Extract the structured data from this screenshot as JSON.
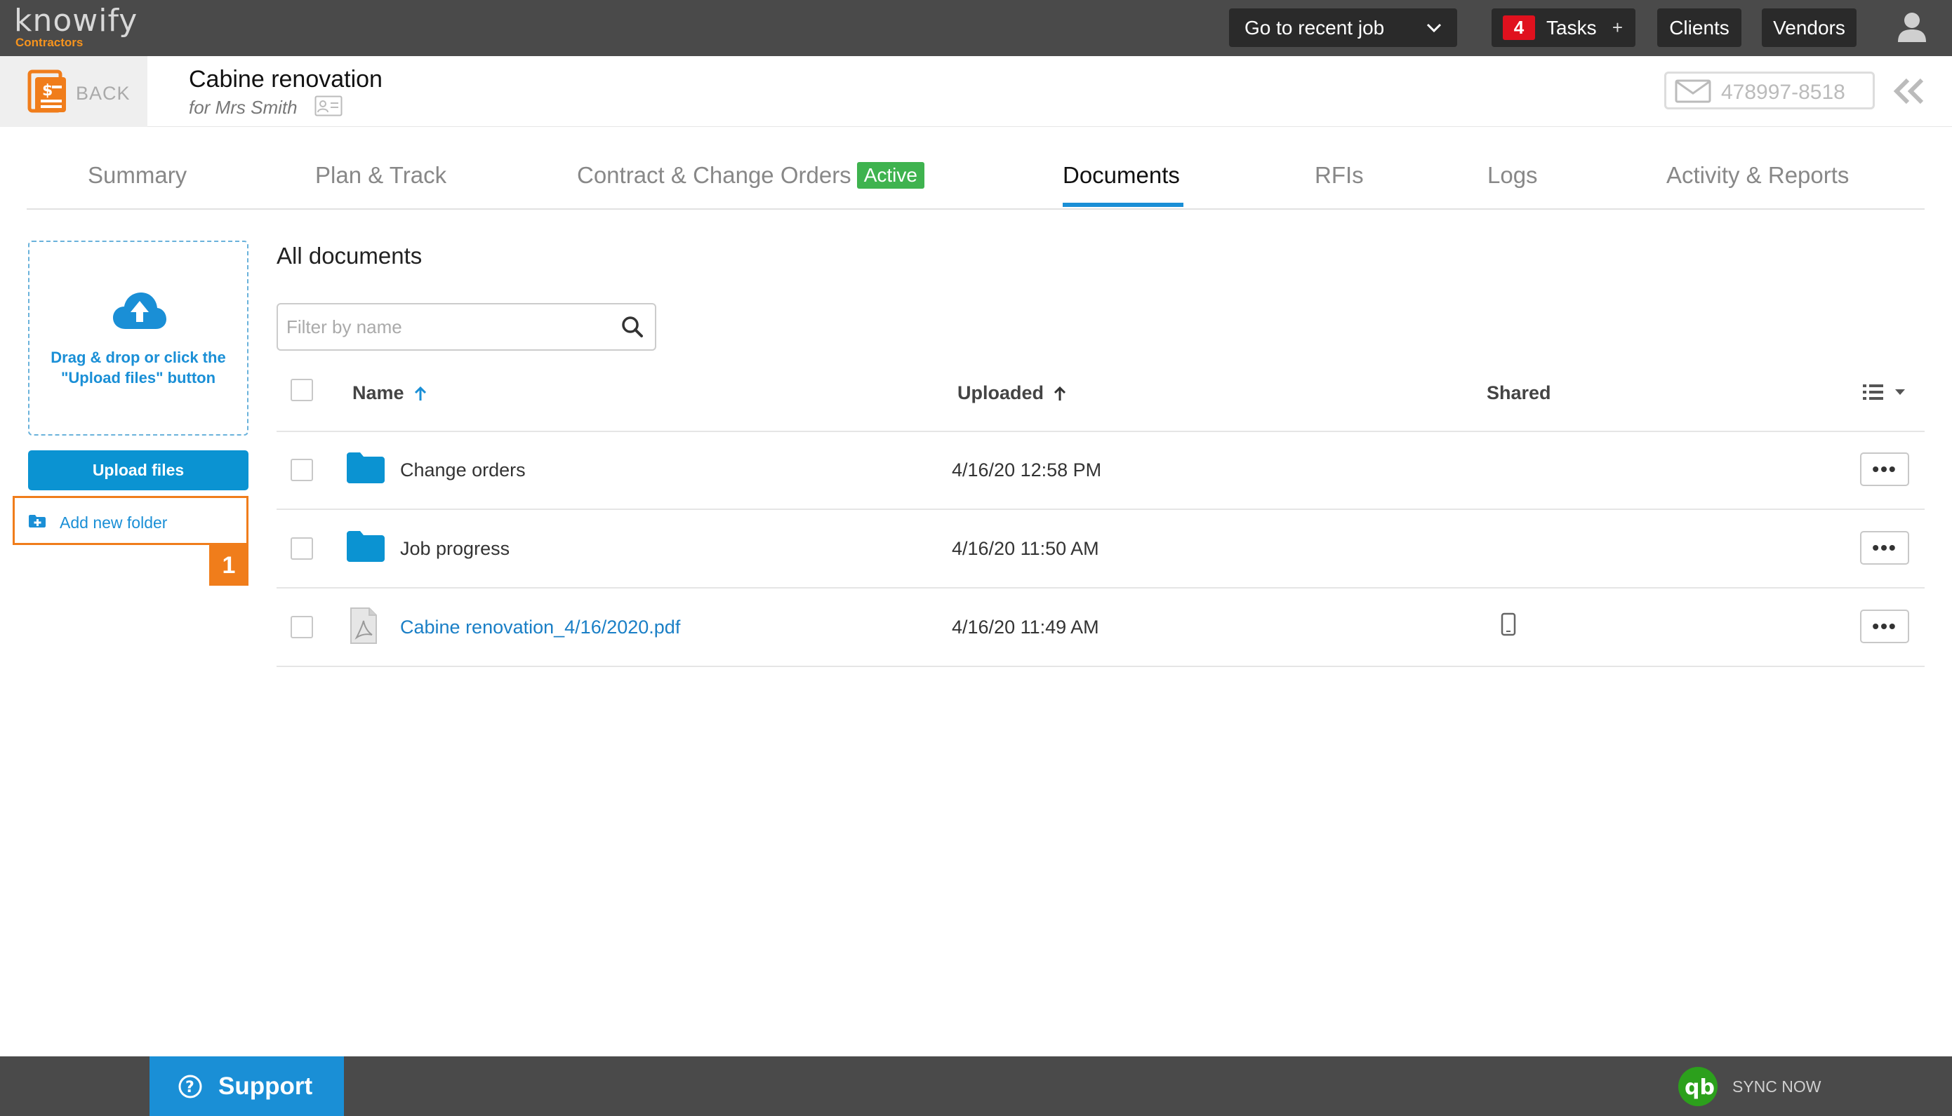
{
  "app": {
    "logo_text": "knowify",
    "logo_sub": "Contractors"
  },
  "topbar": {
    "recent_job_label": "Go to recent job",
    "tasks_count": "4",
    "tasks_label": "Tasks",
    "tasks_plus": "+",
    "clients_label": "Clients",
    "vendors_label": "Vendors"
  },
  "job": {
    "back_label": "BACK",
    "title": "Cabine renovation",
    "client": "for Mrs Smith",
    "email_id": "478997-8518"
  },
  "tabs": [
    {
      "label": "Summary",
      "active": false
    },
    {
      "label": "Plan & Track",
      "active": false
    },
    {
      "label": "Contract & Change Orders",
      "badge": "Active",
      "active": false
    },
    {
      "label": "Documents",
      "active": true
    },
    {
      "label": "RFIs",
      "active": false
    },
    {
      "label": "Logs",
      "active": false
    },
    {
      "label": "Activity & Reports",
      "active": false
    }
  ],
  "upload": {
    "dropzone_text_1": "Drag & drop or click the",
    "dropzone_text_2": "\"Upload files\" button",
    "upload_button": "Upload files",
    "add_folder": "Add new folder",
    "step_number": "1"
  },
  "documents": {
    "title": "All documents",
    "filter_placeholder": "Filter by name",
    "columns": {
      "name": "Name",
      "uploaded": "Uploaded",
      "shared": "Shared"
    },
    "rows": [
      {
        "type": "folder",
        "name": "Change orders",
        "uploaded": "4/16/20 12:58 PM",
        "shared": false
      },
      {
        "type": "folder",
        "name": "Job progress",
        "uploaded": "4/16/20 11:50 AM",
        "shared": false
      },
      {
        "type": "pdf",
        "name": "Cabine renovation_4/16/2020.pdf",
        "uploaded": "4/16/20 11:49 AM",
        "shared": true
      }
    ],
    "more_label": "•••"
  },
  "bottombar": {
    "support_label": "Support",
    "sync_label": "SYNC NOW"
  },
  "colors": {
    "accent_blue": "#1a8fd6",
    "highlight_orange": "#f07d1b",
    "active_green": "#3fb34f",
    "task_red": "#e0111e",
    "bar_gray": "#4a4a4a"
  }
}
